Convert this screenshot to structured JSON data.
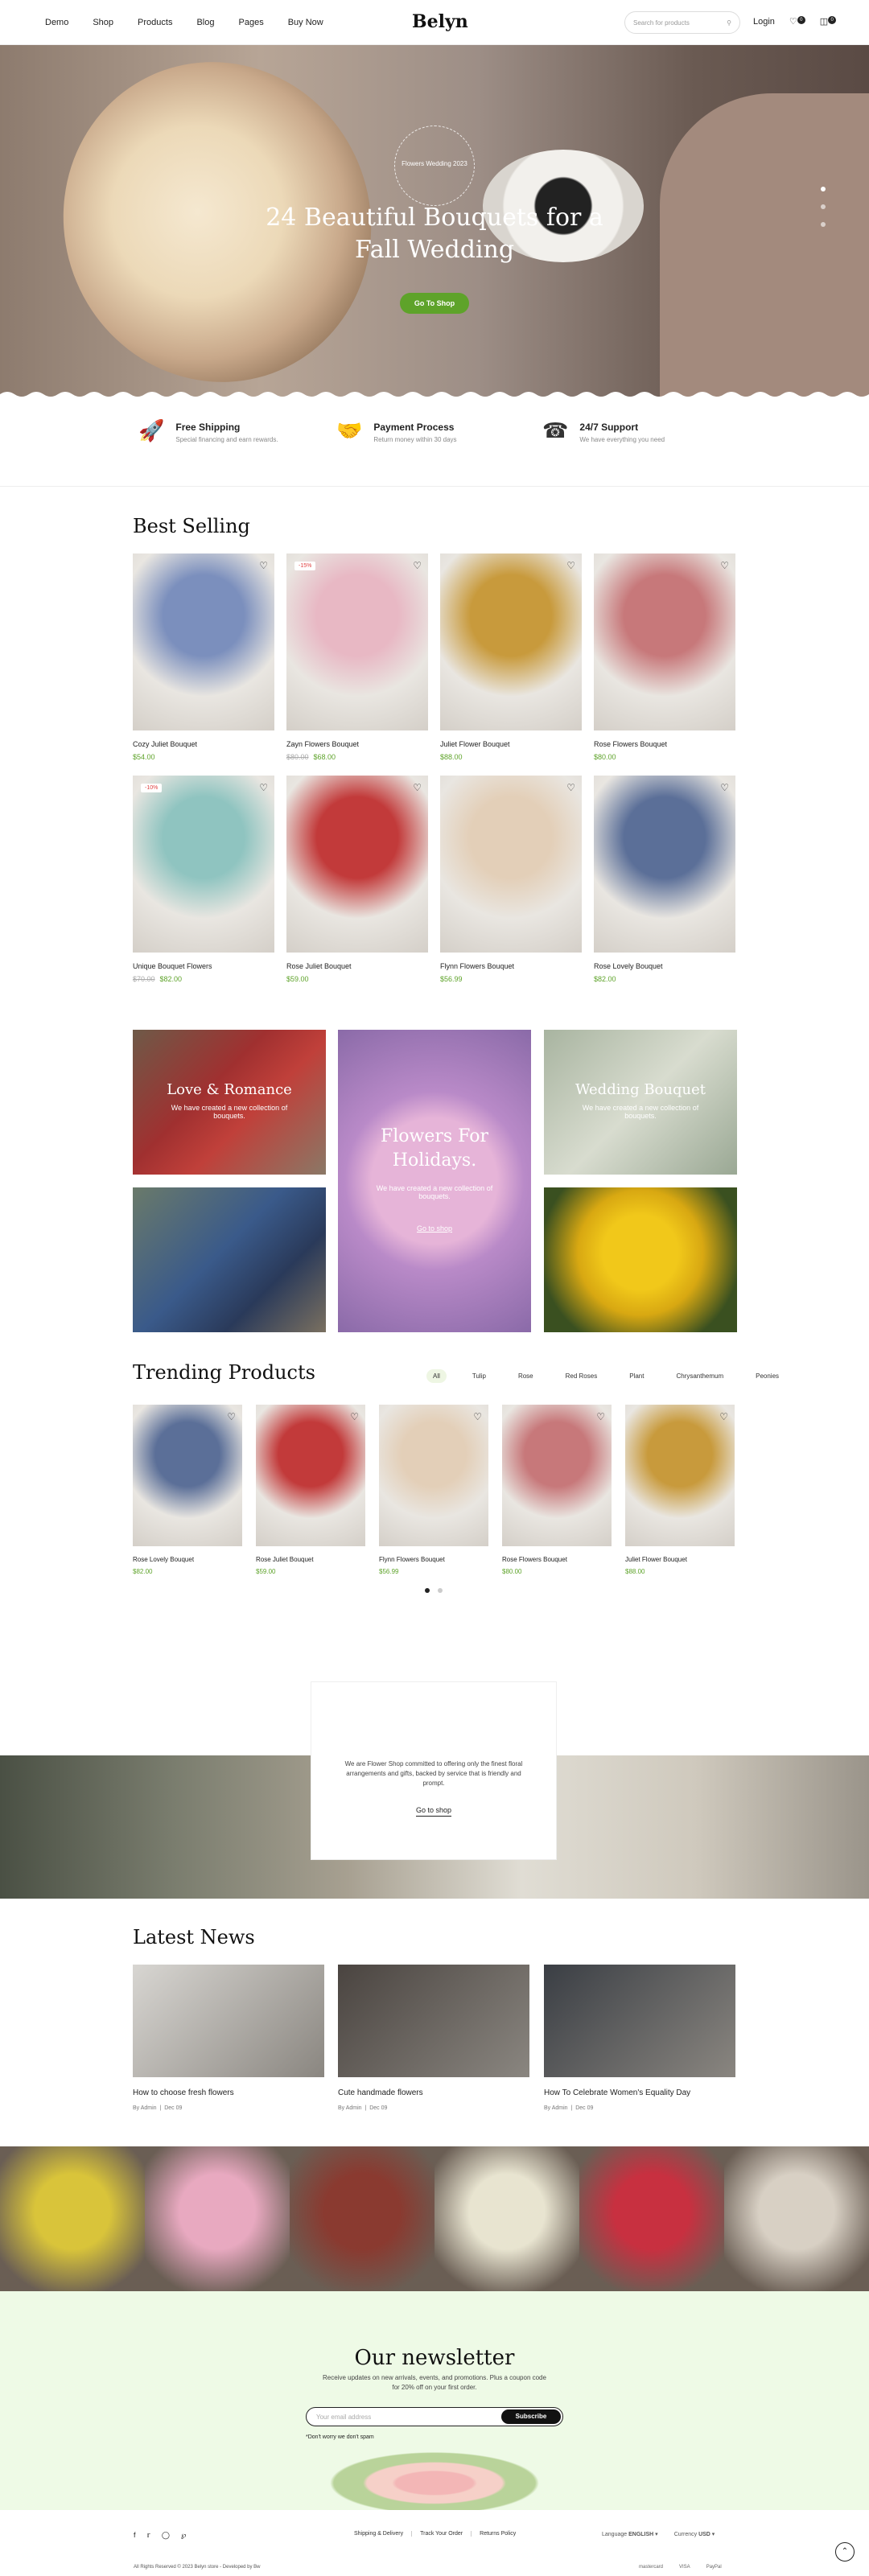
{
  "header": {
    "nav": [
      "Demo",
      "Shop",
      "Products",
      "Blog",
      "Pages",
      "Buy Now"
    ],
    "logo": "Belyn",
    "search_placeholder": "Search for products",
    "login": "Login",
    "wishlist_count": "0",
    "cart_count": "0"
  },
  "hero": {
    "badge_text": "Flowers Wedding 2023",
    "title": "24 Beautiful Bouquets for a Fall Wedding",
    "button": "Go To Shop"
  },
  "features": [
    {
      "icon": "rocket-icon",
      "title": "Free Shipping",
      "text": "Special financing and earn rewards."
    },
    {
      "icon": "handshake-icon",
      "title": "Payment Process",
      "text": "Return money within 30 days"
    },
    {
      "icon": "support-phone-icon",
      "title": "24/7 Support",
      "text": "We have everything you need"
    }
  ],
  "best_selling": {
    "title": "Best Selling",
    "products": [
      {
        "name": "Cozy Juliet Bouquet",
        "price": "$54.00",
        "old": "",
        "sale": "",
        "color": "#7b8fbd"
      },
      {
        "name": "Zayn Flowers Bouquet",
        "price": "$68.00",
        "old": "$80.00",
        "sale": "-15%",
        "color": "#e8b8c4"
      },
      {
        "name": "Juliet Flower Bouquet",
        "price": "$88.00",
        "old": "",
        "sale": "",
        "color": "#c89a3c"
      },
      {
        "name": "Rose Flowers Bouquet",
        "price": "$80.00",
        "old": "",
        "sale": "",
        "color": "#c7787a"
      },
      {
        "name": "Unique Bouquet Flowers",
        "price": "$82.00",
        "old": "$70.00",
        "sale": "-10%",
        "color": "#8fc4c0"
      },
      {
        "name": "Rose Juliet Bouquet",
        "price": "$59.00",
        "old": "",
        "sale": "",
        "color": "#c23a3a"
      },
      {
        "name": "Flynn Flowers Bouquet",
        "price": "$56.99",
        "old": "",
        "sale": "",
        "color": "#e3cfb8"
      },
      {
        "name": "Rose Lovely Bouquet",
        "price": "$82.00",
        "old": "",
        "sale": "",
        "color": "#5b6f98"
      }
    ]
  },
  "banners": [
    {
      "title": "Love & Romance",
      "text": "We have created a new collection of bouquets."
    },
    {
      "title": "Flowers For Holidays.",
      "text": "We have created a new collection of bouquets.",
      "link": "Go to shop"
    },
    {
      "title": "Wedding Bouquet",
      "text": "We have created a new collection of bouquets."
    }
  ],
  "trending": {
    "title": "Trending Products",
    "tabs": [
      "All",
      "Tulip",
      "Rose",
      "Red Roses",
      "Plant",
      "Chrysanthemum",
      "Peonies"
    ],
    "products": [
      {
        "name": "Rose Lovely Bouquet",
        "price": "$82.00",
        "color": "#5b6f98"
      },
      {
        "name": "Rose Juliet Bouquet",
        "price": "$59.00",
        "color": "#c23a3a"
      },
      {
        "name": "Flynn Flowers Bouquet",
        "price": "$56.99",
        "color": "#e3cfb8"
      },
      {
        "name": "Rose Flowers Bouquet",
        "price": "$80.00",
        "color": "#c7787a"
      },
      {
        "name": "Juliet Flower Bouquet",
        "price": "$88.00",
        "color": "#c89a3c"
      }
    ]
  },
  "quote": {
    "text": "We are Flower Shop committed to offering only the finest floral arrangements and gifts, backed by service that is friendly and prompt.",
    "link": "Go to shop"
  },
  "news": {
    "title": "Latest News",
    "posts": [
      {
        "title": "How to choose fresh flowers",
        "author": "By Admin",
        "date": "Dec 09",
        "color": "#d8d6d2"
      },
      {
        "title": "Cute handmade flowers",
        "author": "By Admin",
        "date": "Dec 09",
        "color": "#4a4440"
      },
      {
        "title": "How To Celebrate Women's Equality Day",
        "author": "By Admin",
        "date": "Dec 09",
        "color": "#3a3e44"
      }
    ]
  },
  "gallery_colors": [
    "#d9c43a",
    "#e8a9c0",
    "#8a3a30",
    "#e8e4d0",
    "#c83040",
    "#d8d0c4"
  ],
  "newsletter": {
    "title": "Our newsletter",
    "text": "Receive updates on new arrivals, events, and promotions. Plus a coupon code for 20% off on your first order.",
    "placeholder": "Your email address",
    "button": "Subscribe",
    "note": "*Don't worry we don't spam"
  },
  "footer": {
    "links": [
      "Shipping & Delivery",
      "Track Your Order",
      "Returns Policy"
    ],
    "language_label": "Language",
    "language": "ENGLISH",
    "currency_label": "Currency",
    "currency": "USD",
    "copyright": "All Rights Reserved © 2023 Belyn store - Developed by Bw",
    "payments": [
      "mastercard",
      "VISA",
      "PayPal"
    ]
  }
}
